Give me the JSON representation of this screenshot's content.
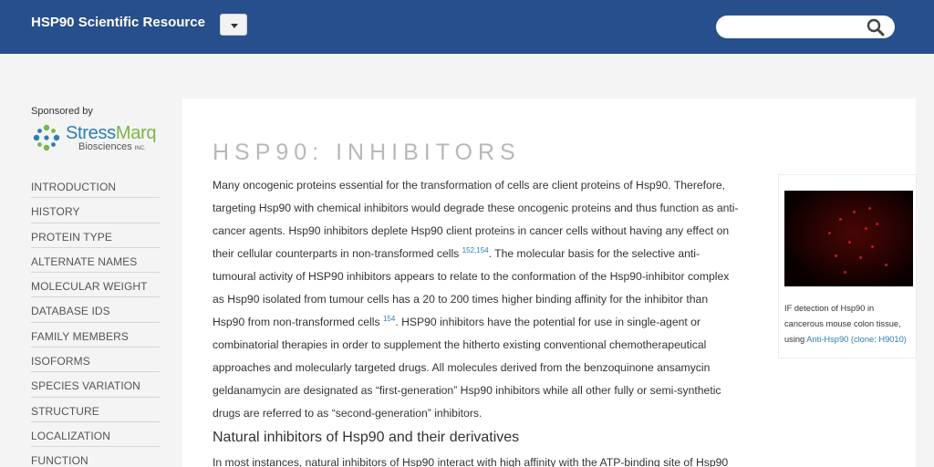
{
  "header": {
    "brand": "HSP90 Scientific Resource",
    "search_placeholder": ""
  },
  "sidebar": {
    "sponsor_label": "Sponsored by",
    "sponsor_logo": {
      "name_part1": "Stress",
      "name_part2": "Marq",
      "sub": "Biosciences",
      "sub_small": "INC."
    },
    "items": [
      {
        "label": "INTRODUCTION"
      },
      {
        "label": "HISTORY"
      },
      {
        "label": "PROTEIN TYPE"
      },
      {
        "label": "ALTERNATE NAMES"
      },
      {
        "label": "MOLECULAR WEIGHT"
      },
      {
        "label": "DATABASE IDS"
      },
      {
        "label": "FAMILY MEMBERS"
      },
      {
        "label": "ISOFORMS"
      },
      {
        "label": "SPECIES VARIATION"
      },
      {
        "label": "STRUCTURE"
      },
      {
        "label": "LOCALIZATION"
      },
      {
        "label": "FUNCTION"
      }
    ]
  },
  "main": {
    "title": "HSP90: INHIBITORS",
    "p1_a": "Many oncogenic proteins essential for the transformation of cells are client proteins of Hsp90. Therefore, targeting Hsp90 with chemical inhibitors would degrade these oncogenic proteins and thus function as anti-cancer agents. Hsp90 inhibitors deplete Hsp90 client proteins in cancer cells without having any effect on their cellular counterparts in non-transformed cells ",
    "ref1": "152,154",
    "p1_b": ". The molecular basis for the selective anti-tumoural activity of HSP90 inhibitors appears to relate to the conformation of the Hsp90-inhibitor complex as Hsp90 isolated from tumour cells has a 20 to 200 times higher binding affinity for the inhibitor than Hsp90 from non-transformed cells ",
    "ref2": "154",
    "p1_c": ". HSP90 inhibitors have the potential for use in single-agent or combinatorial therapies in order to supplement the hitherto existing conventional chemotherapeutical approaches and molecularly targeted drugs. All molecules derived from the benzoquinone ansamycin geldanamycin are designated as “first-generation” Hsp90 inhibitors while all other fully or semi-synthetic drugs are referred to as “second-generation” inhibitors.",
    "subheading": "Natural inhibitors of Hsp90 and their derivatives",
    "p2": "In most instances, natural inhibitors of Hsp90 interact with high affinity with the ATP-binding site of Hsp90"
  },
  "figure": {
    "caption": "IF detection of Hsp90 in cancerous mouse colon tissue, using ",
    "link": "Anti-Hsp90 (clone: H9010)"
  }
}
